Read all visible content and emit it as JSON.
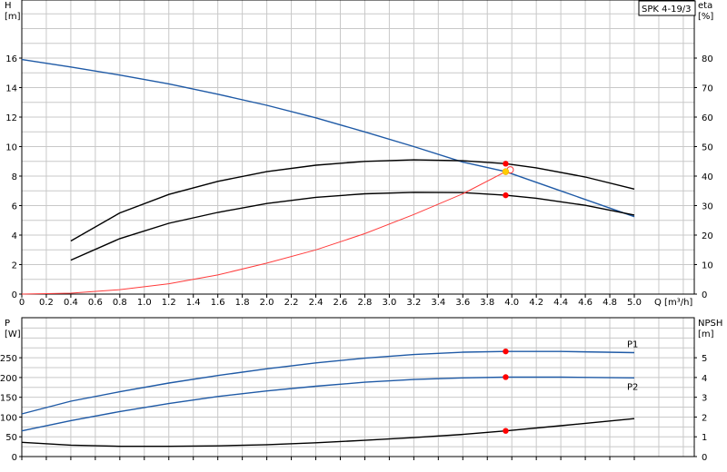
{
  "title_box": "SPK 4-19/3",
  "chart_data": [
    {
      "type": "line",
      "title": "",
      "xlabel": "Q [m³/h]",
      "ylabel_left": [
        "H",
        "[m]"
      ],
      "ylabel_right": [
        "eta",
        "[%]"
      ],
      "xlim": [
        0,
        5.0
      ],
      "ylim_left": [
        0,
        18
      ],
      "ylim_right": [
        0,
        90
      ],
      "x_ticks": [
        "0",
        "0.2",
        "0.4",
        "0.6",
        "0.8",
        "1.0",
        "1.2",
        "1.4",
        "1.6",
        "1.8",
        "2.0",
        "2.2",
        "2.4",
        "2.6",
        "2.8",
        "3.0",
        "3.2",
        "3.4",
        "3.6",
        "3.8",
        "4.0",
        "4.2",
        "4.4",
        "4.6",
        "4.8",
        "5.0"
      ],
      "y_ticks_left": [
        "0",
        "2",
        "4",
        "6",
        "8",
        "10",
        "12",
        "14",
        "16"
      ],
      "y_ticks_right": [
        "0",
        "10",
        "20",
        "30",
        "40",
        "50",
        "60",
        "70",
        "80"
      ],
      "grid": true,
      "series": [
        {
          "axis": "left",
          "color": "#1f5aa6",
          "x": [
            0,
            0.4,
            0.8,
            1.2,
            1.6,
            2.0,
            2.4,
            2.8,
            3.2,
            3.6,
            3.95,
            4.4,
            5.0
          ],
          "y": [
            15.9,
            15.4,
            14.85,
            14.25,
            13.55,
            12.8,
            11.95,
            11.0,
            10.0,
            8.95,
            8.3,
            7.0,
            5.25
          ]
        },
        {
          "axis": "right",
          "color": "#000000",
          "x": [
            0.4,
            0.8,
            1.2,
            1.6,
            2.0,
            2.4,
            2.8,
            3.2,
            3.6,
            3.95,
            4.2,
            4.6,
            5.0
          ],
          "y": [
            18,
            27.5,
            33.8,
            38.2,
            41.5,
            43.7,
            45.0,
            45.5,
            45.2,
            44.2,
            42.8,
            39.7,
            35.6
          ]
        },
        {
          "axis": "right",
          "color": "#000000",
          "x": [
            0.4,
            0.8,
            1.2,
            1.6,
            2.0,
            2.4,
            2.8,
            3.2,
            3.6,
            3.95,
            4.2,
            4.6,
            5.0
          ],
          "y": [
            11.5,
            18.8,
            24.0,
            27.7,
            30.7,
            32.8,
            34.0,
            34.5,
            34.4,
            33.5,
            32.5,
            30.1,
            26.8
          ]
        },
        {
          "axis": "right",
          "color": "#ff3b3b",
          "x": [
            0,
            0.4,
            0.8,
            1.2,
            1.6,
            2.0,
            2.4,
            2.8,
            3.2,
            3.6,
            3.95
          ],
          "y": [
            0,
            0.3,
            1.5,
            3.5,
            6.5,
            10.5,
            15.0,
            20.5,
            27.0,
            34.0,
            41.5
          ]
        }
      ],
      "markers": [
        {
          "axis": "right",
          "x": 3.95,
          "y": 44.2,
          "color": "#ff0000"
        },
        {
          "axis": "right",
          "x": 3.95,
          "y": 33.5,
          "color": "#ff0000"
        },
        {
          "axis": "left",
          "x": 3.95,
          "y": 8.3,
          "color": "#ffcc00"
        }
      ]
    },
    {
      "type": "line",
      "title": "",
      "ylabel_left": [
        "P",
        "[W]"
      ],
      "ylabel_right": [
        "NPSH",
        "[m]"
      ],
      "xlim": [
        0,
        5.0
      ],
      "ylim_left": [
        0,
        300
      ],
      "ylim_right": [
        0,
        6
      ],
      "y_ticks_left": [
        "0",
        "50",
        "100",
        "150",
        "200",
        "250"
      ],
      "y_ticks_right": [
        "0",
        "1",
        "2",
        "3",
        "4",
        "5"
      ],
      "grid": true,
      "series": [
        {
          "name": "P1",
          "axis": "left",
          "color": "#1f5aa6",
          "x": [
            0,
            0.4,
            0.8,
            1.2,
            1.6,
            2.0,
            2.4,
            2.8,
            3.2,
            3.6,
            3.95,
            4.4,
            5.0
          ],
          "y": [
            108,
            140,
            164,
            186,
            205,
            222,
            237,
            249,
            258,
            264,
            266,
            266,
            263
          ]
        },
        {
          "name": "P2",
          "axis": "left",
          "color": "#1f5aa6",
          "x": [
            0,
            0.4,
            0.8,
            1.2,
            1.6,
            2.0,
            2.4,
            2.8,
            3.2,
            3.6,
            3.95,
            4.4,
            5.0
          ],
          "y": [
            65,
            91,
            114,
            134,
            152,
            166,
            178,
            188,
            195,
            199,
            201,
            201,
            199
          ]
        },
        {
          "axis": "right",
          "color": "#000000",
          "x": [
            0,
            0.4,
            0.8,
            1.2,
            1.6,
            2.0,
            2.4,
            2.8,
            3.2,
            3.6,
            3.95,
            4.4,
            5.0
          ],
          "y": [
            0.72,
            0.58,
            0.52,
            0.52,
            0.54,
            0.6,
            0.7,
            0.82,
            0.96,
            1.12,
            1.3,
            1.56,
            1.92
          ]
        }
      ],
      "markers": [
        {
          "axis": "left",
          "x": 3.95,
          "y": 266,
          "color": "#ff0000"
        },
        {
          "axis": "left",
          "x": 3.95,
          "y": 201,
          "color": "#ff0000"
        },
        {
          "axis": "right",
          "x": 3.95,
          "y": 1.3,
          "color": "#ff0000"
        }
      ]
    }
  ]
}
